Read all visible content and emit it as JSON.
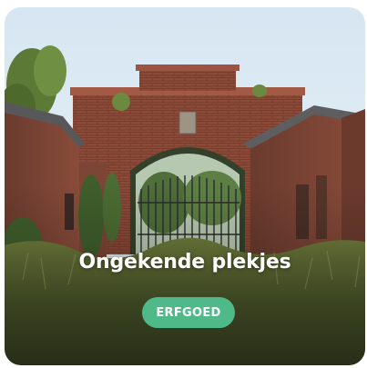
{
  "card": {
    "title": "Ongekende plekjes",
    "badge": "ERFGOED",
    "badge_color": "#4fb98a",
    "image_subject": "overgrown-brick-gate-photo"
  }
}
